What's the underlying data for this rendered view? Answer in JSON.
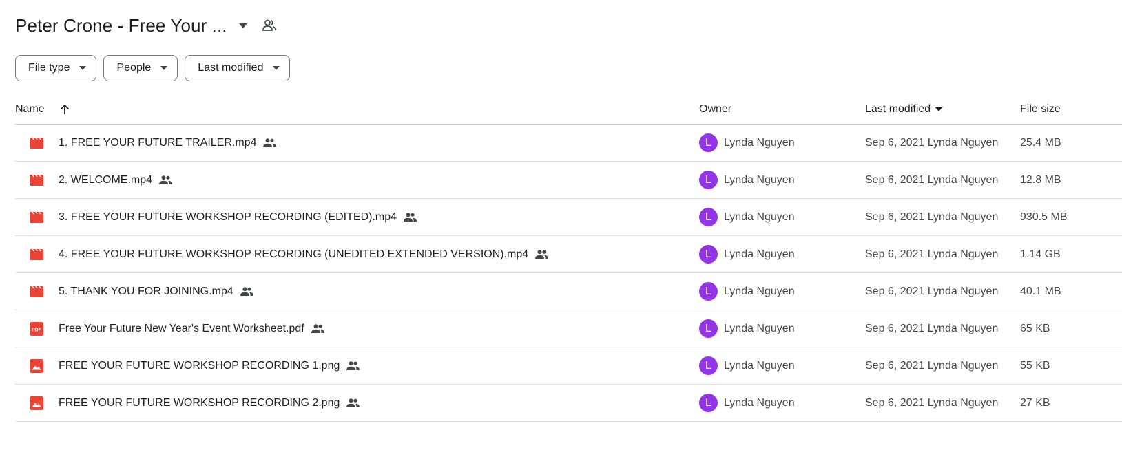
{
  "header": {
    "title": "Peter Crone - Free Your ...",
    "title_icon": "chevron-down-icon",
    "shared_icon": "shared-people-icon"
  },
  "filters": [
    {
      "label": "File type"
    },
    {
      "label": "People"
    },
    {
      "label": "Last modified"
    }
  ],
  "table": {
    "columns": {
      "name": "Name",
      "owner": "Owner",
      "last_modified": "Last modified",
      "file_size": "File size"
    },
    "sort": {
      "column": "Name",
      "direction": "ascending",
      "icon": "arrow-up-icon"
    },
    "rows": [
      {
        "icon": "video-icon",
        "name": "1. FREE YOUR FUTURE TRAILER.mp4",
        "owner_initial": "L",
        "owner": "Lynda Nguyen",
        "modified": "Sep 6, 2021 Lynda Nguyen",
        "size": "25.4 MB"
      },
      {
        "icon": "video-icon",
        "name": "2. WELCOME.mp4",
        "owner_initial": "L",
        "owner": "Lynda Nguyen",
        "modified": "Sep 6, 2021 Lynda Nguyen",
        "size": "12.8 MB"
      },
      {
        "icon": "video-icon",
        "name": "3. FREE YOUR FUTURE WORKSHOP RECORDING (EDITED).mp4",
        "owner_initial": "L",
        "owner": "Lynda Nguyen",
        "modified": "Sep 6, 2021 Lynda Nguyen",
        "size": "930.5 MB"
      },
      {
        "icon": "video-icon",
        "name": "4. FREE YOUR FUTURE WORKSHOP RECORDING (UNEDITED EXTENDED VERSION).mp4",
        "owner_initial": "L",
        "owner": "Lynda Nguyen",
        "modified": "Sep 6, 2021 Lynda Nguyen",
        "size": "1.14 GB"
      },
      {
        "icon": "video-icon",
        "name": "5. THANK YOU FOR JOINING.mp4",
        "owner_initial": "L",
        "owner": "Lynda Nguyen",
        "modified": "Sep 6, 2021 Lynda Nguyen",
        "size": "40.1 MB"
      },
      {
        "icon": "pdf-icon",
        "name": "Free Your Future New Year's Event Worksheet.pdf",
        "owner_initial": "L",
        "owner": "Lynda Nguyen",
        "modified": "Sep 6, 2021 Lynda Nguyen",
        "size": "65 KB"
      },
      {
        "icon": "image-icon",
        "name": "FREE YOUR FUTURE WORKSHOP RECORDING 1.png",
        "owner_initial": "L",
        "owner": "Lynda Nguyen",
        "modified": "Sep 6, 2021 Lynda Nguyen",
        "size": "55 KB"
      },
      {
        "icon": "image-icon",
        "name": "FREE YOUR FUTURE WORKSHOP RECORDING 2.png",
        "owner_initial": "L",
        "owner": "Lynda Nguyen",
        "modified": "Sep 6, 2021 Lynda Nguyen",
        "size": "27 KB"
      }
    ]
  },
  "colors": {
    "file_icon_red": "#ea4335",
    "avatar_purple": "#9334e6",
    "text": "#1f1f1f",
    "muted_text": "#444746"
  }
}
